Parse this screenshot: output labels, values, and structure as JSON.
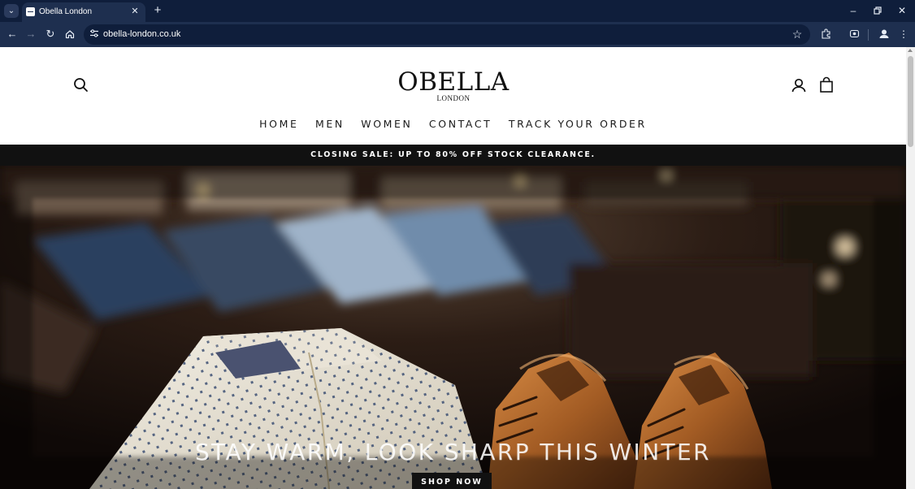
{
  "browser": {
    "tab": {
      "title": "Obella London"
    },
    "address_bar": {
      "url": "obella-london.co.uk"
    },
    "icons": [
      "tab-search-icon",
      "close-icon",
      "new-tab-icon",
      "minimize-icon",
      "restore-icon",
      "close-window-icon",
      "back-icon",
      "forward-icon",
      "reload-icon",
      "home-icon",
      "site-info-icon",
      "bookmark-star-icon",
      "extensions-icon",
      "screenshot-icon",
      "profile-icon",
      "menu-kebab-icon"
    ]
  },
  "site": {
    "logo": {
      "brand": "OBELLA",
      "sub": "LONDON"
    },
    "nav": [
      {
        "label": "HOME"
      },
      {
        "label": "MEN"
      },
      {
        "label": "WOMEN"
      },
      {
        "label": "CONTACT"
      },
      {
        "label": "TRACK YOUR ORDER"
      }
    ],
    "icons": [
      "search-icon",
      "account-icon",
      "cart-bag-icon"
    ],
    "announcement": "CLOSING SALE: UP TO 80% OFF STOCK CLEARANCE.",
    "hero": {
      "title": "STAY WARM, LOOK SHARP THIS WINTER",
      "cta": "SHOP NOW"
    }
  },
  "colors": {
    "chrome_dark": "#0f1e3b",
    "chrome_toolbar": "#1e2f4f",
    "announcement_bg": "#111111",
    "text_dark": "#1b1b1b",
    "shoe_leather": "#a8622a"
  }
}
